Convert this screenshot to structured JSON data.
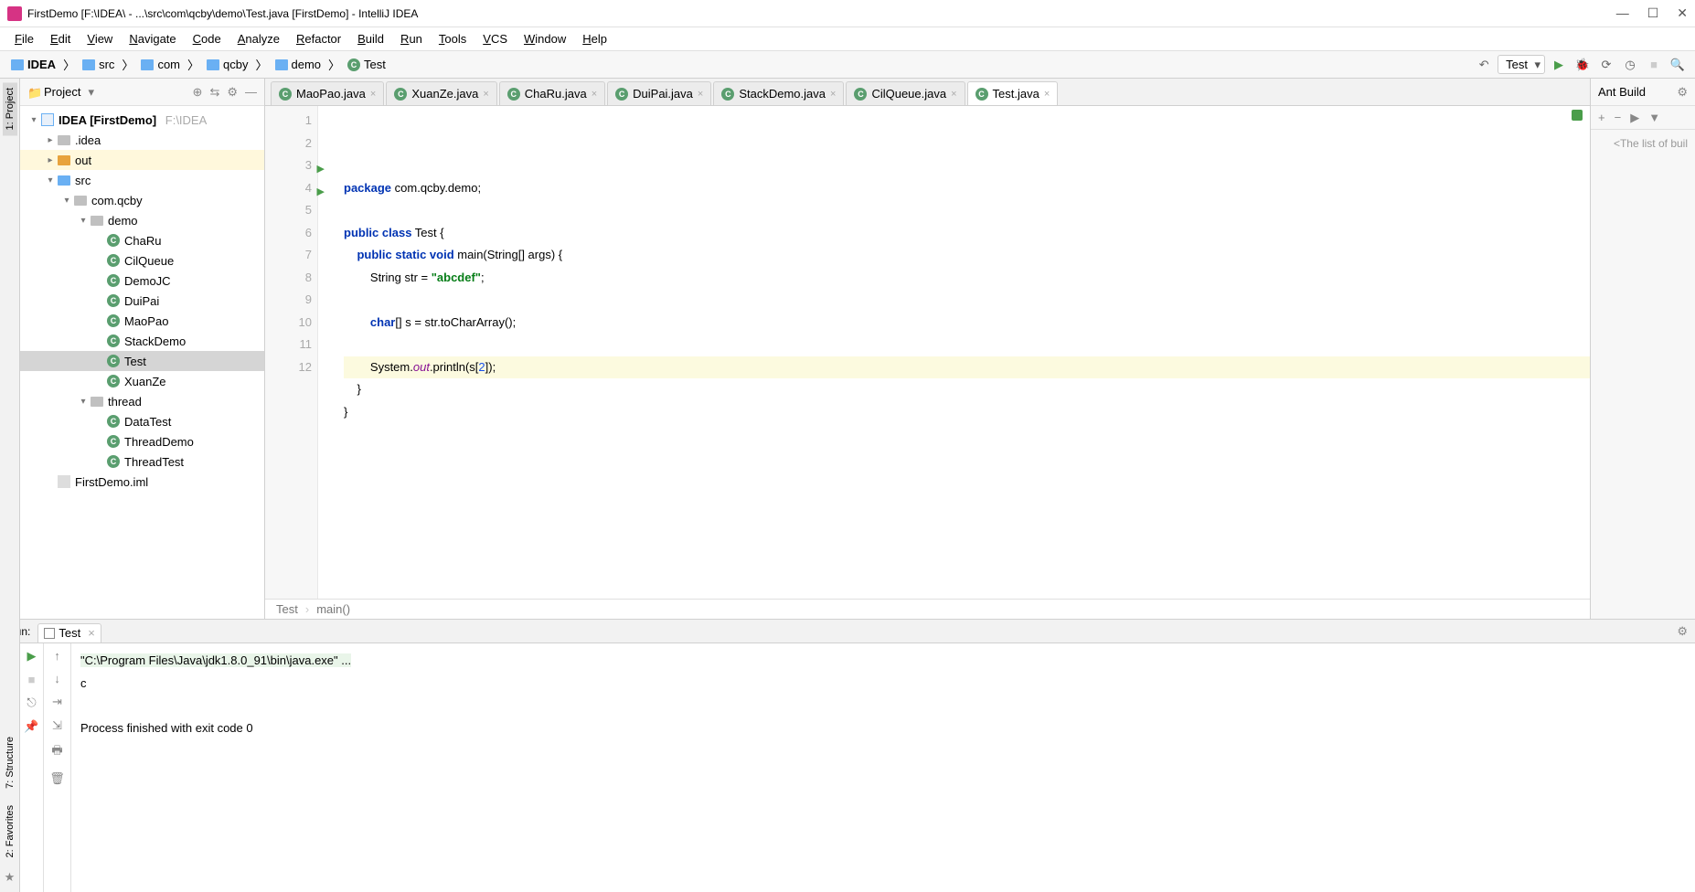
{
  "window": {
    "title": "FirstDemo [F:\\IDEA\\ - ...\\src\\com\\qcby\\demo\\Test.java [FirstDemo] - IntelliJ IDEA"
  },
  "menu": [
    "File",
    "Edit",
    "View",
    "Navigate",
    "Code",
    "Analyze",
    "Refactor",
    "Build",
    "Run",
    "Tools",
    "VCS",
    "Window",
    "Help"
  ],
  "breadcrumbs": [
    {
      "label": "IDEA",
      "type": "folder"
    },
    {
      "label": "src",
      "type": "folder"
    },
    {
      "label": "com",
      "type": "folder"
    },
    {
      "label": "qcby",
      "type": "folder"
    },
    {
      "label": "demo",
      "type": "folder"
    },
    {
      "label": "Test",
      "type": "class"
    }
  ],
  "run_config": "Test",
  "project": {
    "title": "Project",
    "tree": [
      {
        "depth": 0,
        "arrow": "▾",
        "icon": "mod",
        "label": "IDEA [FirstDemo]",
        "suffix": "F:\\IDEA",
        "bold": true
      },
      {
        "depth": 1,
        "arrow": "▸",
        "icon": "folder-grey",
        "label": ".idea"
      },
      {
        "depth": 1,
        "arrow": "▸",
        "icon": "folder-orange",
        "label": "out",
        "hl": true
      },
      {
        "depth": 1,
        "arrow": "▾",
        "icon": "folder",
        "label": "src"
      },
      {
        "depth": 2,
        "arrow": "▾",
        "icon": "folder-grey",
        "label": "com.qcby"
      },
      {
        "depth": 3,
        "arrow": "▾",
        "icon": "folder-grey",
        "label": "demo"
      },
      {
        "depth": 4,
        "arrow": "",
        "icon": "class",
        "label": "ChaRu"
      },
      {
        "depth": 4,
        "arrow": "",
        "icon": "class",
        "label": "CilQueue"
      },
      {
        "depth": 4,
        "arrow": "",
        "icon": "class",
        "label": "DemoJC"
      },
      {
        "depth": 4,
        "arrow": "",
        "icon": "class",
        "label": "DuiPai"
      },
      {
        "depth": 4,
        "arrow": "",
        "icon": "class",
        "label": "MaoPao"
      },
      {
        "depth": 4,
        "arrow": "",
        "icon": "class",
        "label": "StackDemo"
      },
      {
        "depth": 4,
        "arrow": "",
        "icon": "class",
        "label": "Test",
        "selected": true
      },
      {
        "depth": 4,
        "arrow": "",
        "icon": "class",
        "label": "XuanZe"
      },
      {
        "depth": 3,
        "arrow": "▾",
        "icon": "folder-grey",
        "label": "thread"
      },
      {
        "depth": 4,
        "arrow": "",
        "icon": "class",
        "label": "DataTest"
      },
      {
        "depth": 4,
        "arrow": "",
        "icon": "class",
        "label": "ThreadDemo"
      },
      {
        "depth": 4,
        "arrow": "",
        "icon": "class",
        "label": "ThreadTest"
      },
      {
        "depth": 1,
        "arrow": "",
        "icon": "file",
        "label": "FirstDemo.iml"
      }
    ]
  },
  "tabs": [
    {
      "label": "MaoPao.java"
    },
    {
      "label": "XuanZe.java"
    },
    {
      "label": "ChaRu.java"
    },
    {
      "label": "DuiPai.java"
    },
    {
      "label": "StackDemo.java"
    },
    {
      "label": "CilQueue.java"
    },
    {
      "label": "Test.java",
      "active": true
    }
  ],
  "code": {
    "lines": [
      {
        "n": 1,
        "html": "<span class='kw'>package</span> com.qcby.demo;"
      },
      {
        "n": 2,
        "html": ""
      },
      {
        "n": 3,
        "html": "<span class='kw'>public class</span> Test {",
        "run": true
      },
      {
        "n": 4,
        "html": "    <span class='kw'>public static void</span> main(String[] args) {",
        "run": true
      },
      {
        "n": 5,
        "html": "        String str = <span class='str'>\"abcdef\"</span>;"
      },
      {
        "n": 6,
        "html": ""
      },
      {
        "n": 7,
        "html": "        <span class='kw'>char</span>[] s = str.toCharArray();"
      },
      {
        "n": 8,
        "html": ""
      },
      {
        "n": 9,
        "html": "        System.<span class='fld'>out</span>.println(s[<span class='num'>2</span>]);",
        "hl": true
      },
      {
        "n": 10,
        "html": "    }"
      },
      {
        "n": 11,
        "html": "}"
      },
      {
        "n": 12,
        "html": ""
      }
    ],
    "crumb1": "Test",
    "crumb2": "main()"
  },
  "ant": {
    "title": "Ant Build",
    "body": "<The list of buil"
  },
  "run": {
    "label": "Run:",
    "tab": "Test",
    "console_cmd": "\"C:\\Program Files\\Java\\jdk1.8.0_91\\bin\\java.exe\" ...",
    "console_out": "c",
    "console_exit": "Process finished with exit code 0"
  },
  "left_tabs": {
    "project": "1: Project",
    "structure": "7: Structure",
    "favorites": "2: Favorites"
  }
}
